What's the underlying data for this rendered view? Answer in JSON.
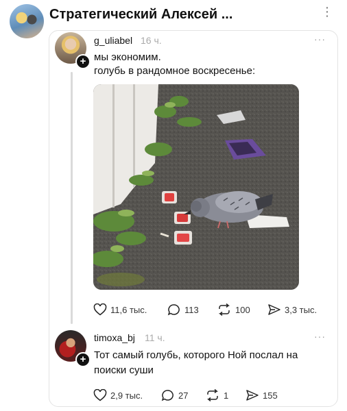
{
  "header": {
    "channel_title": "Стратегический Алексей ...",
    "more_icon": "⋮"
  },
  "post": {
    "username": "g_uliabel",
    "time": "16 ч.",
    "more": "···",
    "lines": [
      "мы экономим.",
      "голубь в рандомное воскресенье:"
    ],
    "image_icon": "pigeon-photo",
    "likes": "11,6 тыс.",
    "comments": "113",
    "reposts": "100",
    "shares": "3,3 тыс."
  },
  "reply": {
    "username": "timoxa_bj",
    "time": "11 ч.",
    "more": "···",
    "lines": [
      "Тот самый голубь, которого Ной послал на",
      "поиски суши"
    ],
    "likes": "2,9 тыс.",
    "comments": "27",
    "reposts": "1",
    "shares": "155"
  }
}
